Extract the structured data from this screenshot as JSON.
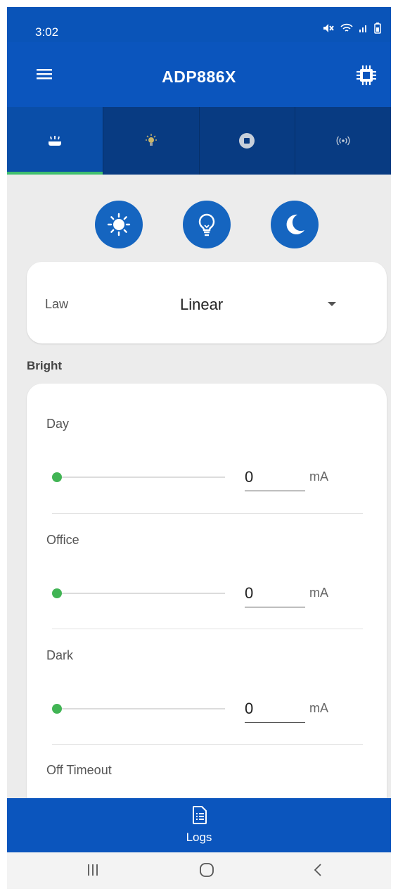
{
  "status_bar": {
    "time": "3:02"
  },
  "app_bar": {
    "title": "ADP886X"
  },
  "law": {
    "label": "Law",
    "value": "Linear"
  },
  "bright": {
    "section_title": "Bright",
    "rows": [
      {
        "label": "Day",
        "value": "0",
        "unit": "mA",
        "slider_level": 0
      },
      {
        "label": "Office",
        "value": "0",
        "unit": "mA",
        "slider_level": 0
      },
      {
        "label": "Dark",
        "value": "0",
        "unit": "mA",
        "slider_level": 0
      },
      {
        "label": "Off Timeout"
      }
    ]
  },
  "bottom_bar": {
    "logs_label": "Logs"
  },
  "colors": {
    "primary": "#0b55bd",
    "tab_bg": "#083b82",
    "accent_green": "#41b454",
    "mode_button": "#1565c0"
  },
  "icons": [
    "menu-icon",
    "chip-icon",
    "led-bar-icon",
    "bulb-icon",
    "stop-icon",
    "broadcast-icon",
    "sun-icon",
    "lightbulb-icon",
    "moon-icon",
    "dropdown-caret-icon",
    "logs-icon"
  ]
}
